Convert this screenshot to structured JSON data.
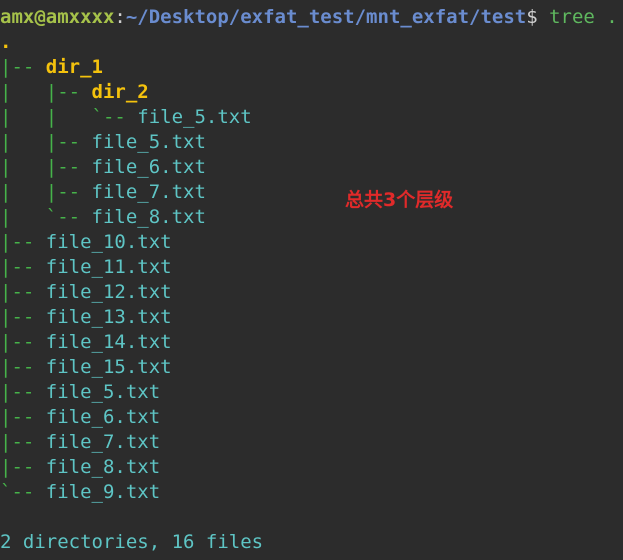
{
  "prompt": {
    "user_host": "amx@amxxxx",
    "separator": ":",
    "path": "~/Desktop/exfat_test/mnt_exfat/test",
    "dollar": "$",
    "command": " tree ."
  },
  "tree": {
    "root": ".",
    "lines": [
      {
        "prefix": "|-- ",
        "name": "dir_1"
      },
      {
        "prefix": "|   |-- ",
        "name": "dir_2"
      },
      {
        "prefix": "|   |   `-- ",
        "name": "file_5.txt"
      },
      {
        "prefix": "|   |-- ",
        "name": "file_5.txt"
      },
      {
        "prefix": "|   |-- ",
        "name": "file_6.txt"
      },
      {
        "prefix": "|   |-- ",
        "name": "file_7.txt"
      },
      {
        "prefix": "|   `-- ",
        "name": "file_8.txt"
      },
      {
        "prefix": "|-- ",
        "name": "file_10.txt"
      },
      {
        "prefix": "|-- ",
        "name": "file_11.txt"
      },
      {
        "prefix": "|-- ",
        "name": "file_12.txt"
      },
      {
        "prefix": "|-- ",
        "name": "file_13.txt"
      },
      {
        "prefix": "|-- ",
        "name": "file_14.txt"
      },
      {
        "prefix": "|-- ",
        "name": "file_15.txt"
      },
      {
        "prefix": "|-- ",
        "name": "file_5.txt"
      },
      {
        "prefix": "|-- ",
        "name": "file_6.txt"
      },
      {
        "prefix": "|-- ",
        "name": "file_7.txt"
      },
      {
        "prefix": "|-- ",
        "name": "file_8.txt"
      },
      {
        "prefix": "`-- ",
        "name": "file_9.txt"
      }
    ]
  },
  "summary": "2 directories, 16 files",
  "annotation": "总共3个层级",
  "colors": {
    "background": "#2c2c2c",
    "directory": "#f4c20d",
    "file": "#5ec5c5",
    "branch": "#46b34a",
    "annotation": "#e02a2a"
  }
}
